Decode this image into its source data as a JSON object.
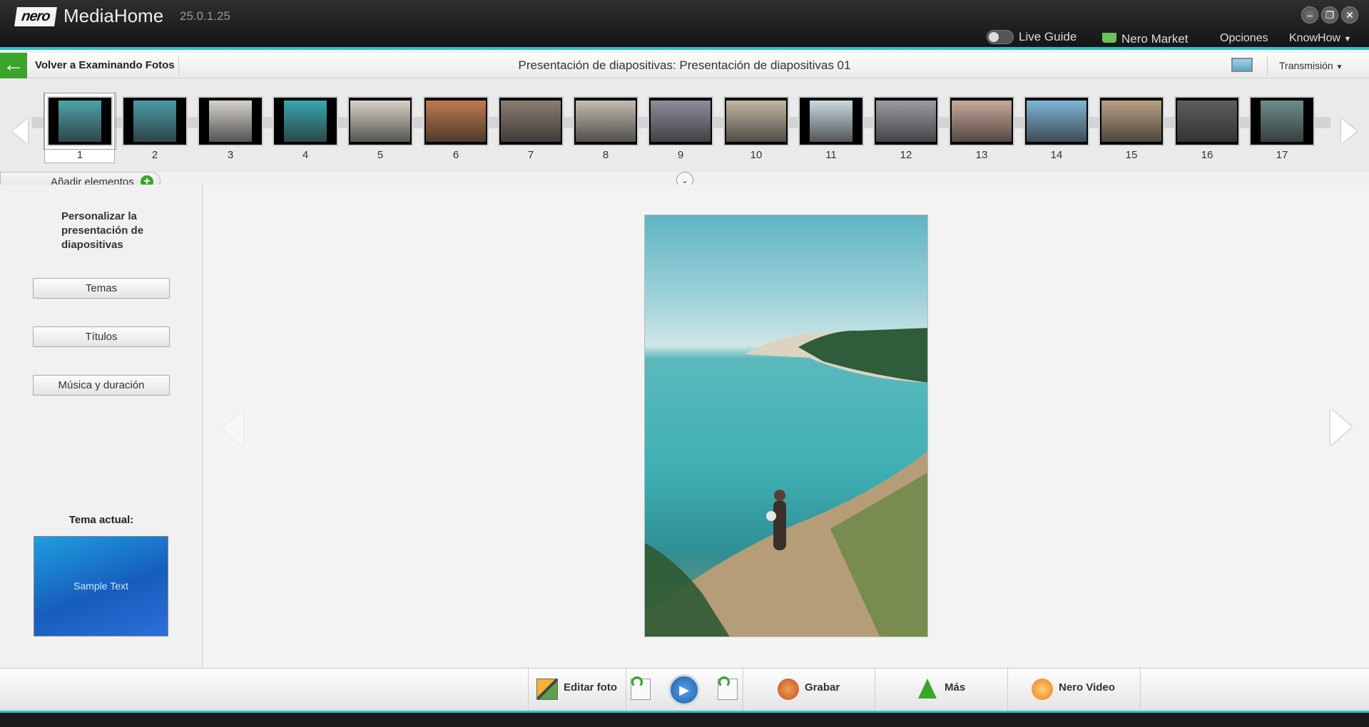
{
  "app": {
    "logo_text": "nero",
    "name": "MediaHome",
    "version": "25.0.1.25"
  },
  "window": {
    "minimize_glyph": "–",
    "restore_glyph": "❐",
    "close_glyph": "✕"
  },
  "topmenu": {
    "live_guide": "Live Guide",
    "nero_market": "Nero Market",
    "options": "Opciones",
    "knowhow": "KnowHow"
  },
  "nav": {
    "back_label": "Volver a Examinando Fotos",
    "title": "Presentación de diapositivas: Presentación de diapositivas 01",
    "transmision": "Transmisión"
  },
  "filmstrip": {
    "thumbs": [
      {
        "num": "1",
        "color": "#4da3a8"
      },
      {
        "num": "2",
        "color": "#4b9ba5"
      },
      {
        "num": "3",
        "color": "#d5d1cb"
      },
      {
        "num": "4",
        "color": "#3aa6ad"
      },
      {
        "num": "5",
        "color": "#d7d2c8"
      },
      {
        "num": "6",
        "color": "#c07a4e"
      },
      {
        "num": "7",
        "color": "#8b7d72"
      },
      {
        "num": "8",
        "color": "#c4bcb2"
      },
      {
        "num": "9",
        "color": "#8d8e99"
      },
      {
        "num": "10",
        "color": "#c3b7a3"
      },
      {
        "num": "11",
        "color": "#cad9df"
      },
      {
        "num": "12",
        "color": "#9a9ca3"
      },
      {
        "num": "13",
        "color": "#c9a99a"
      },
      {
        "num": "14",
        "color": "#7fb6d6"
      },
      {
        "num": "15",
        "color": "#b8a083"
      },
      {
        "num": "16",
        "color": "#5c5e5c"
      },
      {
        "num": "17",
        "color": "#6d8b8a"
      }
    ],
    "add_label": "Añadir elementos",
    "add_glyph": "+",
    "collapse_glyph": "⌄"
  },
  "left": {
    "title": "Personalizar la presentación de diapositivas",
    "temas": "Temas",
    "titulos": "Títulos",
    "musica": "Música y duración",
    "tema_actual": "Tema actual:",
    "sample_text": "Sample Text"
  },
  "toolbar": {
    "edit": "Editar foto",
    "burn": "Grabar",
    "more": "Más",
    "nero_video": "Nero Video",
    "play_glyph": "▶"
  },
  "colors": {
    "accent_cyan": "#2ec2c8",
    "back_green": "#3aa42c",
    "theme_blue": "#1e9ee0"
  },
  "icons": [
    "back-arrow-icon",
    "plus-icon",
    "monitor-icon",
    "chevron-down-icon",
    "basket-icon",
    "edit-photo-icon",
    "rotate-left-icon",
    "rotate-right-icon",
    "play-icon",
    "burn-icon",
    "more-arrow-icon",
    "nero-video-icon"
  ]
}
